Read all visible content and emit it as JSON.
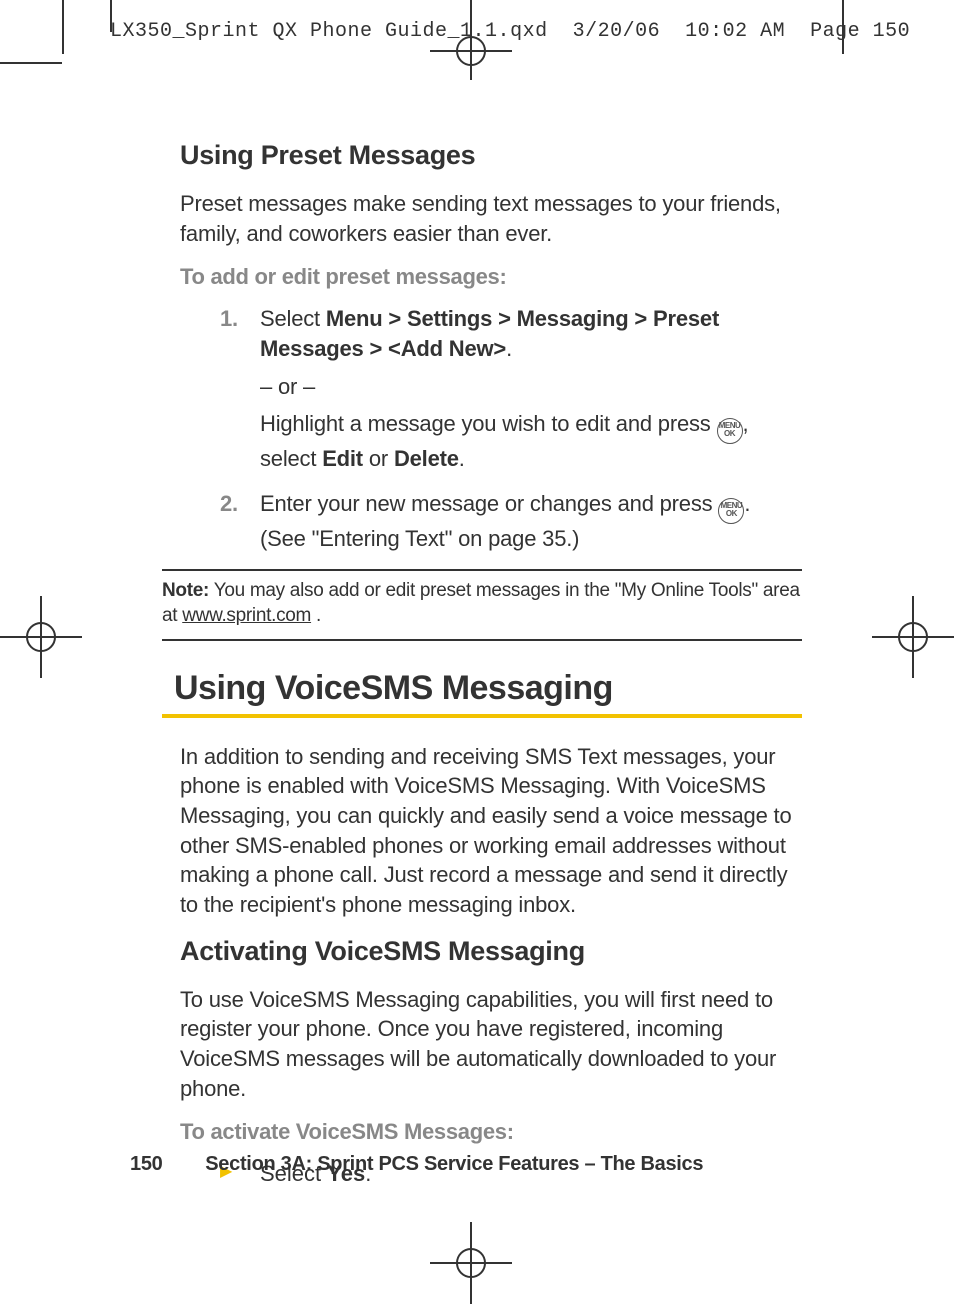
{
  "print_header": {
    "filename": "LX350_Sprint QX Phone Guide_1.1.qxd",
    "date": "3/20/06",
    "time": "10:02 AM",
    "page_label": "Page 150"
  },
  "sections": {
    "preset": {
      "heading": "Using Preset Messages",
      "intro": "Preset messages make sending text messages to your friends, family, and coworkers easier than ever.",
      "lead": "To add or edit preset messages:",
      "step1_num": "1.",
      "step1_a": "Select ",
      "step1_b": "Menu > Settings > Messaging > Preset Messages > <Add New>",
      "step1_c": ".",
      "or": "– or –",
      "step1_alt_a": "Highlight a message you wish to edit and press ",
      "step1_alt_b": ", select ",
      "step1_alt_c": "Edit",
      "step1_alt_d": " or ",
      "step1_alt_e": "Delete",
      "step1_alt_f": ".",
      "step2_num": "2.",
      "step2_a": "Enter your new message or changes and press ",
      "step2_b": ". (See \"Entering Text\" on page 35.)"
    },
    "note": {
      "label": "Note:",
      "text_a": " You may also add or edit preset messages in the \"My Online Tools\" area at ",
      "link": "www.sprint.com",
      "text_b": " ."
    },
    "voicesms": {
      "heading": "Using VoiceSMS Messaging",
      "intro": "In addition to sending and receiving SMS Text messages, your phone is enabled with VoiceSMS Messaging. With VoiceSMS Messaging, you can quickly and easily send a voice message to other SMS-enabled phones or working email addresses without making a phone call. Just record a message and send it directly to the recipient's phone messaging inbox.",
      "sub_heading": "Activating VoiceSMS Messaging",
      "sub_intro": "To use VoiceSMS Messaging capabilities, you will first need to register your phone. Once you have registered, incoming VoiceSMS messages will be automatically downloaded to your phone.",
      "lead": "To activate VoiceSMS Messages:",
      "bullet_a": "Select ",
      "bullet_b": "Yes",
      "bullet_c": "."
    }
  },
  "icon": {
    "menu_ok": "MENU\nOK"
  },
  "footer": {
    "page_number": "150",
    "section_label": "Section 3A: Sprint PCS Service Features – The Basics"
  }
}
